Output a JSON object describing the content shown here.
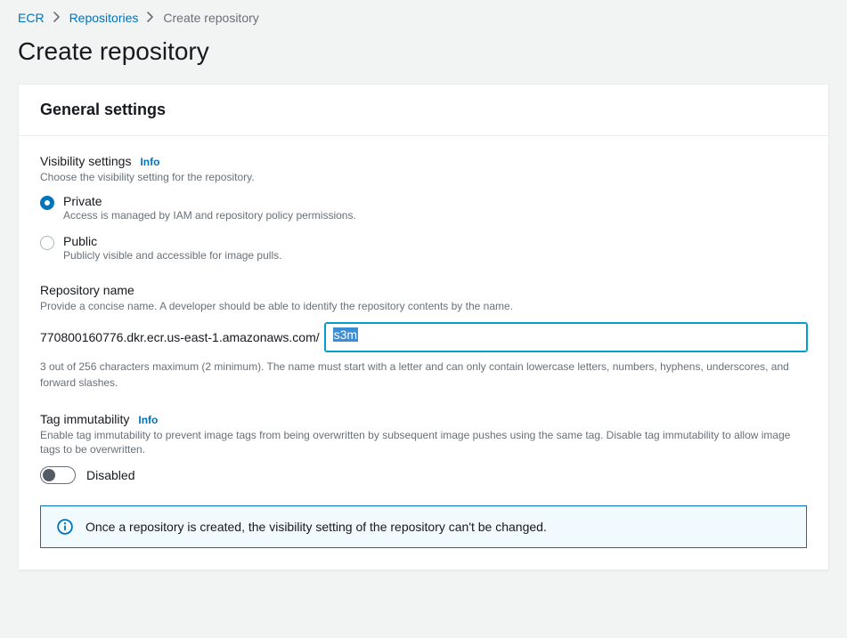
{
  "breadcrumb": {
    "root": "ECR",
    "repositories": "Repositories",
    "current": "Create repository"
  },
  "page_title": "Create repository",
  "panel": {
    "header": "General settings"
  },
  "visibility": {
    "label": "Visibility settings",
    "info": "Info",
    "description": "Choose the visibility setting for the repository.",
    "options": {
      "private": {
        "label": "Private",
        "sub": "Access is managed by IAM and repository policy permissions."
      },
      "public": {
        "label": "Public",
        "sub": "Publicly visible and accessible for image pulls."
      }
    }
  },
  "repo_name": {
    "label": "Repository name",
    "description": "Provide a concise name. A developer should be able to identify the repository contents by the name.",
    "prefix": "770800160776.dkr.ecr.us-east-1.amazonaws.com/",
    "value": "s3m",
    "constraint": "3 out of 256 characters maximum (2 minimum). The name must start with a letter and can only contain lowercase letters, numbers, hyphens, underscores, and forward slashes."
  },
  "tag_immutability": {
    "label": "Tag immutability",
    "info": "Info",
    "description": "Enable tag immutability to prevent image tags from being overwritten by subsequent image pushes using the same tag. Disable tag immutability to allow image tags to be overwritten.",
    "toggle_label": "Disabled"
  },
  "alert": {
    "text": "Once a repository is created, the visibility setting of the repository can't be changed."
  }
}
